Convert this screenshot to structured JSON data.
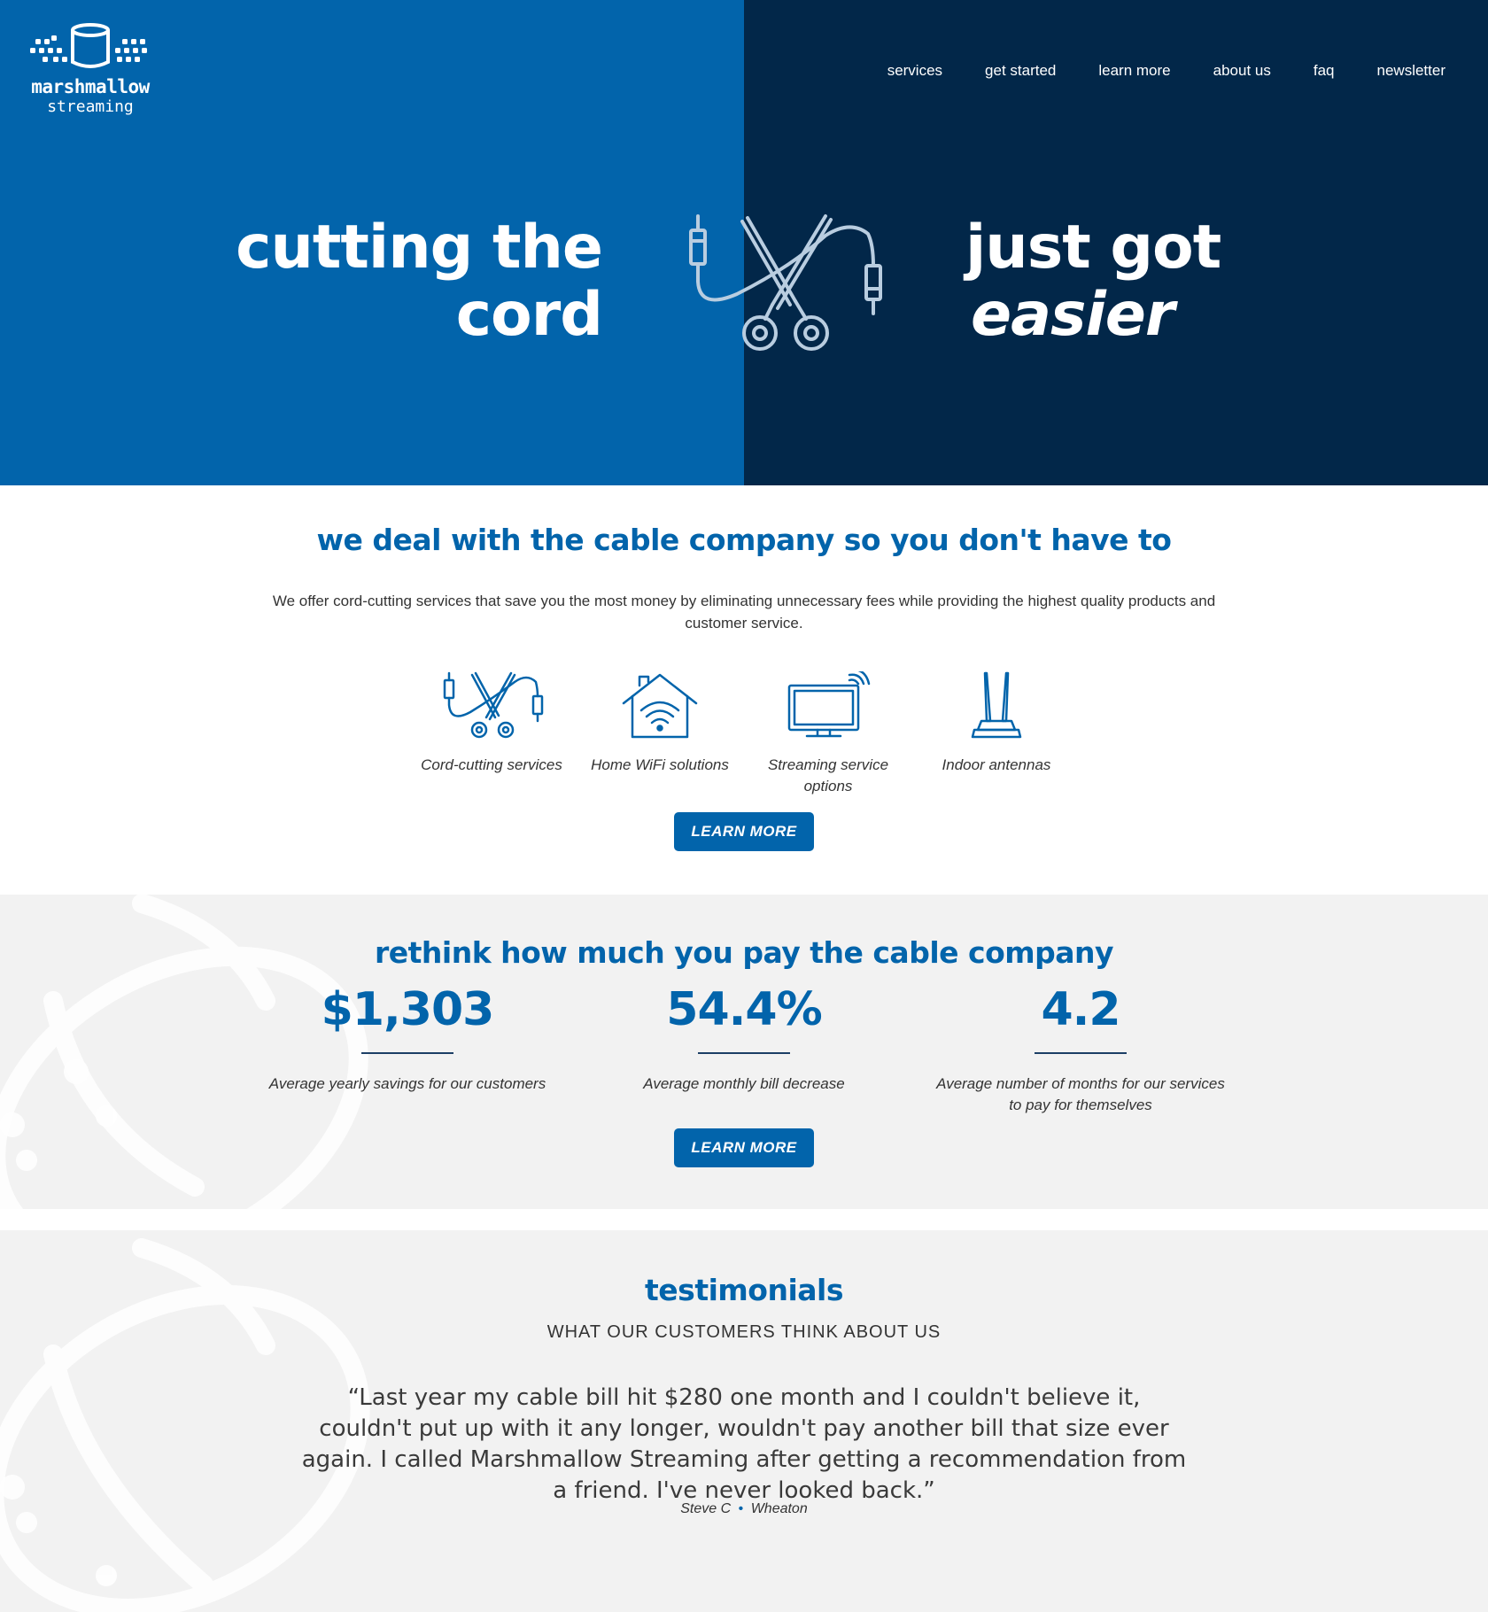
{
  "logo": {
    "word": "marshmallow",
    "sub": "streaming"
  },
  "nav": [
    {
      "label": "services"
    },
    {
      "label": "get started"
    },
    {
      "label": "learn more"
    },
    {
      "label": "about us"
    },
    {
      "label": "faq"
    },
    {
      "label": "newsletter"
    }
  ],
  "hero": {
    "left_line1": "cutting the",
    "left_line2": "cord",
    "right_line1": "just got",
    "right_line2": "easier",
    "icon": "cord-cutting-scissors-icon"
  },
  "section_services": {
    "title": "we deal with the cable company so you don't have to",
    "description": "We offer cord-cutting services that save you the most money by eliminating unnecessary fees while providing the highest quality products and customer service.",
    "features": [
      {
        "label": "Cord-cutting services",
        "icon": "cord-cutting-icon"
      },
      {
        "label": "Home WiFi solutions",
        "icon": "home-wifi-icon"
      },
      {
        "label": "Streaming service options",
        "icon": "tv-streaming-icon"
      },
      {
        "label": "Indoor antennas",
        "icon": "antenna-icon"
      }
    ],
    "button": "LEARN MORE"
  },
  "section_stats": {
    "title": "rethink how much you pay the cable company",
    "stats": [
      {
        "value": "$1,303",
        "label": "Average yearly savings for our customers"
      },
      {
        "value": "54.4%",
        "label": "Average monthly bill decrease"
      },
      {
        "value": "4.2",
        "label": "Average number of months for our services to pay for themselves"
      }
    ],
    "button": "LEARN MORE"
  },
  "section_testimonials": {
    "title": "testimonials",
    "subtitle": "WHAT OUR CUSTOMERS THINK ABOUT US",
    "quote": "“Last year my cable bill hit $280 one month and I couldn't believe it, couldn't put up with it any longer, wouldn't pay another bill that size ever again. I called Marshmallow Streaming after getting a recommendation from a friend. I've never looked back.”",
    "author": "Steve C",
    "location": "Wheaton",
    "separator": "•"
  },
  "colors": {
    "brand_blue": "#0264ab",
    "navy": "#022749",
    "light_gray": "#f2f2f2"
  }
}
